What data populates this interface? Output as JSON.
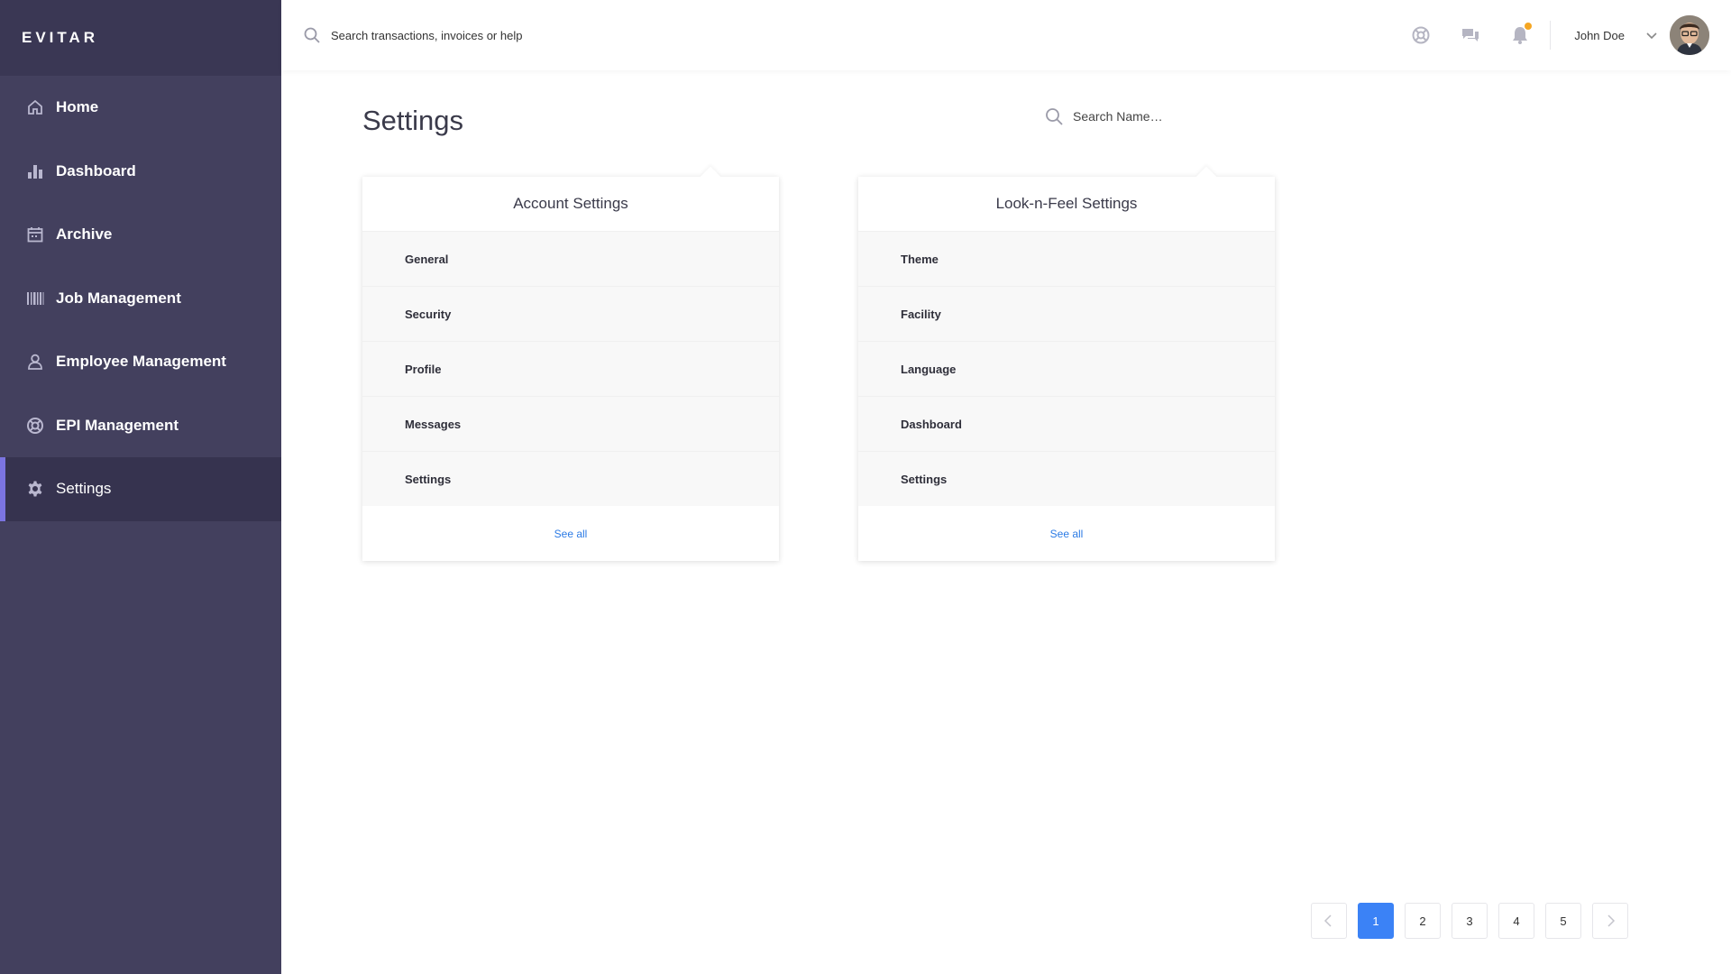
{
  "app": {
    "brand": "EVITAR"
  },
  "sidebar": {
    "items": [
      {
        "label": "Home",
        "icon": "home-icon",
        "active": false
      },
      {
        "label": "Dashboard",
        "icon": "bar-chart-icon",
        "active": false
      },
      {
        "label": "Archive",
        "icon": "calendar-icon",
        "active": false
      },
      {
        "label": "Job Management",
        "icon": "barcode-icon",
        "active": false
      },
      {
        "label": "Employee Management",
        "icon": "user-icon",
        "active": false
      },
      {
        "label": "EPI Management",
        "icon": "lifebuoy-icon",
        "active": false
      },
      {
        "label": "Settings",
        "icon": "gear-icon",
        "active": true
      }
    ]
  },
  "topbar": {
    "search_placeholder": "Search transactions, invoices or help",
    "user_name": "John Doe",
    "icons": [
      "globe-icon",
      "chat-icon",
      "bell-icon",
      "chevron-down-icon"
    ]
  },
  "main": {
    "title": "Settings",
    "name_search_placeholder": "Search Name…",
    "cards": [
      {
        "title": "Account Settings",
        "rows": [
          "General",
          "Security",
          "Profile",
          "Messages",
          "Settings"
        ],
        "footer": "See all"
      },
      {
        "title": "Look-n-Feel Settings",
        "rows": [
          "Theme",
          "Facility",
          "Language",
          "Dashboard",
          "Settings"
        ],
        "footer": "See all"
      }
    ]
  },
  "pagination": {
    "pages": [
      "1",
      "2",
      "3",
      "4",
      "5"
    ],
    "current": "1"
  },
  "colors": {
    "sidebar_bg": "#43405e",
    "sidebar_brand_bg": "#3a3754",
    "active_indicator": "#7b74e0",
    "link": "#2c7be5",
    "pagination_active": "#3b82f6",
    "notification_dot": "#f5a623"
  }
}
